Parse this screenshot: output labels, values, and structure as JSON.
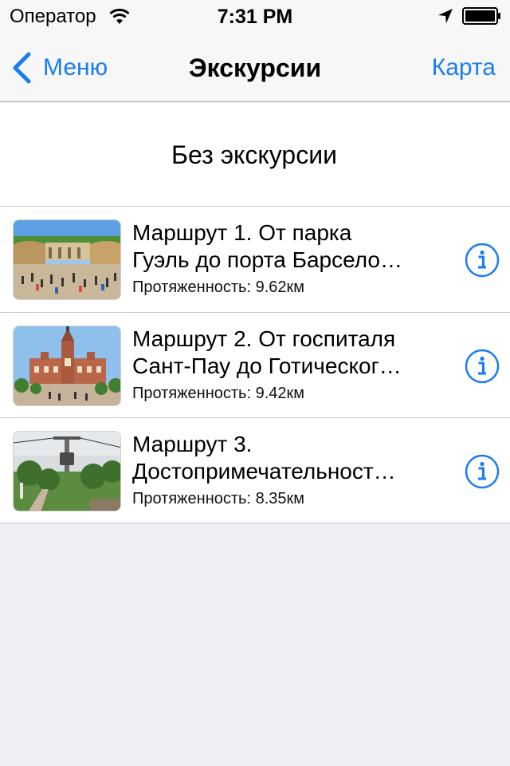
{
  "status_bar": {
    "carrier": "Оператор",
    "time": "7:31 PM",
    "icons": [
      "wifi-icon",
      "location-arrow-icon",
      "battery-icon"
    ]
  },
  "nav": {
    "back_label": "Меню",
    "title": "Экскурсии",
    "right_label": "Карта"
  },
  "no_tour": {
    "label": "Без экскурсии"
  },
  "routes": [
    {
      "title_line1": "Маршрут 1. От парка",
      "title_line2": "Гуэль до порта Барсело…",
      "length": "Протяженность: 9.62км",
      "icon": "info-icon"
    },
    {
      "title_line1": "Маршрут 2. От госпиталя",
      "title_line2": "Сант-Пау до Готическог…",
      "length": "Протяженность: 9.42км",
      "icon": "info-icon"
    },
    {
      "title_line1": "Маршрут 3.",
      "title_line2": "Достопримечательност…",
      "length": "Протяженность: 8.35км",
      "icon": "info-icon"
    }
  ],
  "colors": {
    "accent": "#1a7cf5",
    "background": "#efeff4",
    "bar": "#f7f7f8",
    "separator": "#c8c7cc"
  }
}
